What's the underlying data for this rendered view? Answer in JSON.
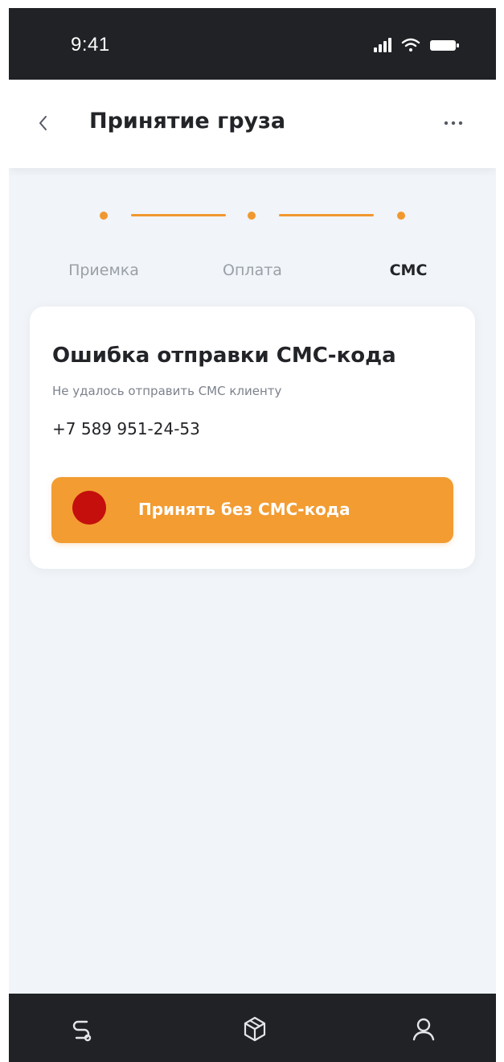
{
  "status_bar": {
    "time": "9:41"
  },
  "header": {
    "title": "Принятие груза"
  },
  "stepper": {
    "steps": [
      {
        "label": "Приемка",
        "active": false
      },
      {
        "label": "Оплата",
        "active": false
      },
      {
        "label": "СМС",
        "active": true
      }
    ]
  },
  "card": {
    "title": "Ошибка отправки СМС-кода",
    "subtitle": "Не удалось отправить СМС клиенту",
    "phone": "+7 589 951-24-53",
    "button_label": "Принять без СМС-кода"
  },
  "bottom_nav": {
    "items": [
      {
        "icon": "route-icon"
      },
      {
        "icon": "package-icon"
      },
      {
        "icon": "user-icon"
      }
    ]
  },
  "colors": {
    "accent": "#f29c32",
    "status_bar": "#212225",
    "background": "#f1f4f8",
    "cursor_marker": "#c40f0c"
  }
}
